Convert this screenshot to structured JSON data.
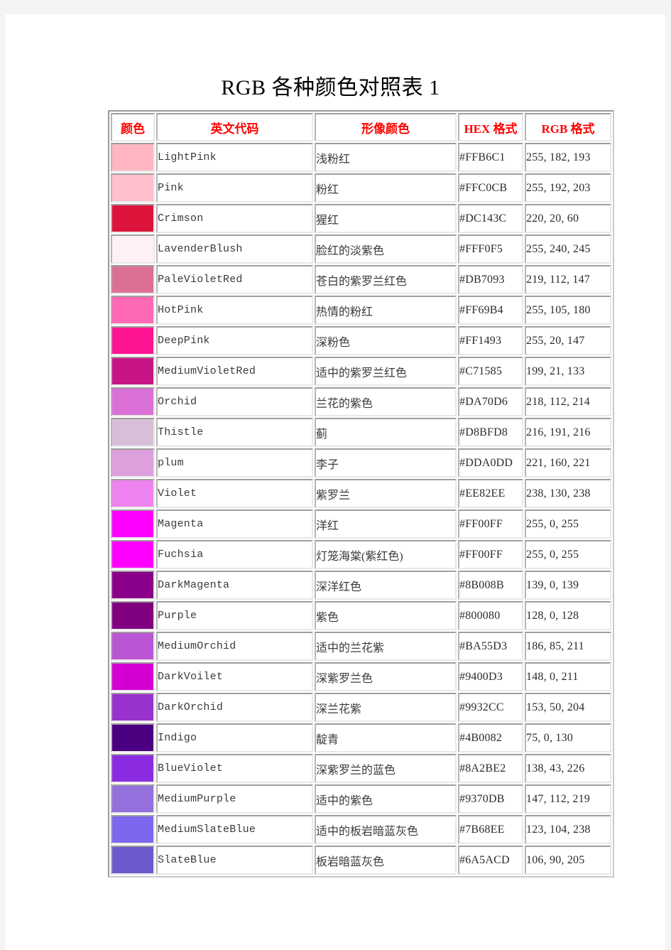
{
  "document": {
    "title": "RGB 各种颜色对照表 1"
  },
  "table": {
    "headers": {
      "swatch": "颜色",
      "english_code": "英文代码",
      "visual_color": "形像颜色",
      "hex_format": "HEX 格式",
      "rgb_format": "RGB 格式"
    },
    "header_color": "#FF0000",
    "rows": [
      {
        "name": "LightPink",
        "cn": "浅粉红",
        "hex": "#FFB6C1",
        "rgb": "255, 182, 193",
        "swatch": "#FFB6C1"
      },
      {
        "name": "Pink",
        "cn": "粉红",
        "hex": "#FFC0CB",
        "rgb": "255, 192, 203",
        "swatch": "#FFC0CB"
      },
      {
        "name": "Crimson",
        "cn": "猩红",
        "hex": "#DC143C",
        "rgb": "220, 20, 60",
        "swatch": "#DC143C"
      },
      {
        "name": "LavenderBlush",
        "cn": "脸红的淡紫色",
        "hex": "#FFF0F5",
        "rgb": "255, 240, 245",
        "swatch": "#FFF0F5"
      },
      {
        "name": "PaleVioletRed",
        "cn": "苍白的紫罗兰红色",
        "hex": "#DB7093",
        "rgb": "219, 112, 147",
        "swatch": "#DB7093"
      },
      {
        "name": "HotPink",
        "cn": "热情的粉红",
        "hex": "#FF69B4",
        "rgb": "255, 105, 180",
        "swatch": "#FF69B4"
      },
      {
        "name": "DeepPink",
        "cn": "深粉色",
        "hex": "#FF1493",
        "rgb": "255, 20, 147",
        "swatch": "#FF1493"
      },
      {
        "name": "MediumVioletRed",
        "cn": "适中的紫罗兰红色",
        "hex": "#C71585",
        "rgb": "199, 21, 133",
        "swatch": "#C71585"
      },
      {
        "name": "Orchid",
        "cn": "兰花的紫色",
        "hex": "#DA70D6",
        "rgb": "218, 112, 214",
        "swatch": "#DA70D6"
      },
      {
        "name": "Thistle",
        "cn": "蓟",
        "hex": "#D8BFD8",
        "rgb": "216, 191, 216",
        "swatch": "#D8BFD8"
      },
      {
        "name": "plum",
        "cn": "李子",
        "hex": "#DDA0DD",
        "rgb": "221, 160, 221",
        "swatch": "#DDA0DD"
      },
      {
        "name": "Violet",
        "cn": "紫罗兰",
        "hex": "#EE82EE",
        "rgb": "238, 130, 238",
        "swatch": "#EE82EE"
      },
      {
        "name": "Magenta",
        "cn": "洋红",
        "hex": "#FF00FF",
        "rgb": "255, 0, 255",
        "swatch": "#FF00FF"
      },
      {
        "name": "Fuchsia",
        "cn": "灯笼海棠(紫红色)",
        "hex": "#FF00FF",
        "rgb": "255, 0, 255",
        "swatch": "#FF00FF"
      },
      {
        "name": "DarkMagenta",
        "cn": "深洋红色",
        "hex": "#8B008B",
        "rgb": "139, 0, 139",
        "swatch": "#8B008B"
      },
      {
        "name": "Purple",
        "cn": "紫色",
        "hex": "#800080",
        "rgb": "128, 0, 128",
        "swatch": "#800080"
      },
      {
        "name": "MediumOrchid",
        "cn": "适中的兰花紫",
        "hex": "#BA55D3",
        "rgb": "186, 85, 211",
        "swatch": "#BA55D3"
      },
      {
        "name": "DarkVoilet",
        "cn": "深紫罗兰色",
        "hex": "#9400D3",
        "rgb": "148, 0, 211",
        "swatch": "#D400D3"
      },
      {
        "name": "DarkOrchid",
        "cn": "深兰花紫",
        "hex": "#9932CC",
        "rgb": "153, 50, 204",
        "swatch": "#9932CC"
      },
      {
        "name": "Indigo",
        "cn": "靛青",
        "hex": "#4B0082",
        "rgb": "75, 0, 130",
        "swatch": "#4B0082"
      },
      {
        "name": "BlueViolet",
        "cn": "深紫罗兰的蓝色",
        "hex": "#8A2BE2",
        "rgb": "138, 43, 226",
        "swatch": "#8A2BE2"
      },
      {
        "name": "MediumPurple",
        "cn": "适中的紫色",
        "hex": "#9370DB",
        "rgb": "147, 112, 219",
        "swatch": "#9370DB"
      },
      {
        "name": "MediumSlateBlue",
        "cn": "适中的板岩暗蓝灰色",
        "hex": "#7B68EE",
        "rgb": "123, 104, 238",
        "swatch": "#7B68EE"
      },
      {
        "name": "SlateBlue",
        "cn": "板岩暗蓝灰色",
        "hex": "#6A5ACD",
        "rgb": "106, 90, 205",
        "swatch": "#6A5ACD"
      }
    ]
  }
}
